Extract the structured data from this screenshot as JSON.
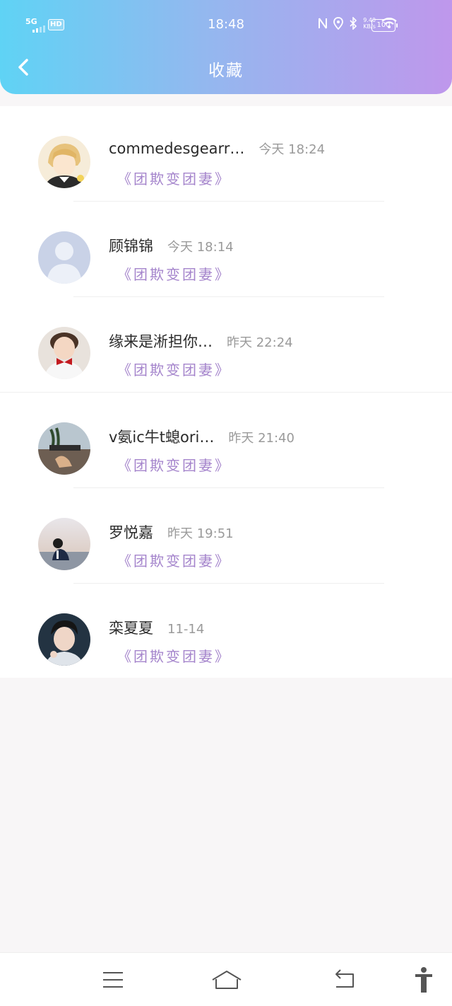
{
  "status_bar": {
    "network": "5G",
    "hd": "HD",
    "time": "18:48",
    "net_speed_value": "9.40",
    "net_speed_unit": "KB/s",
    "battery": "100"
  },
  "header": {
    "title": "收藏"
  },
  "favorites": [
    {
      "name": "commedesgearr…",
      "time": "今天 18:24",
      "book": "《团欺变团妻》"
    },
    {
      "name": "顾锦锦",
      "time": "今天 18:14",
      "book": "《团欺变团妻》"
    },
    {
      "name": "缘来是淅担你…",
      "time": "昨天 22:24",
      "book": "《团欺变团妻》"
    },
    {
      "name": "v氨ic牛t螅ori…",
      "time": "昨天 21:40",
      "book": "《团欺变团妻》"
    },
    {
      "name": "罗悦嘉",
      "time": "昨天 19:51",
      "book": "《团欺变团妻》"
    },
    {
      "name": "栾夏夏",
      "time": "11-14",
      "book": "《团欺变团妻》"
    }
  ],
  "icons": {
    "back": "chevron-left-icon",
    "menu": "menu-icon",
    "home": "home-icon",
    "back_nav": "back-arrow-icon",
    "accessibility": "accessibility-icon"
  },
  "colors": {
    "header_start": "#5fd3f5",
    "header_end": "#bf97ec",
    "book_title": "#a585cc"
  }
}
